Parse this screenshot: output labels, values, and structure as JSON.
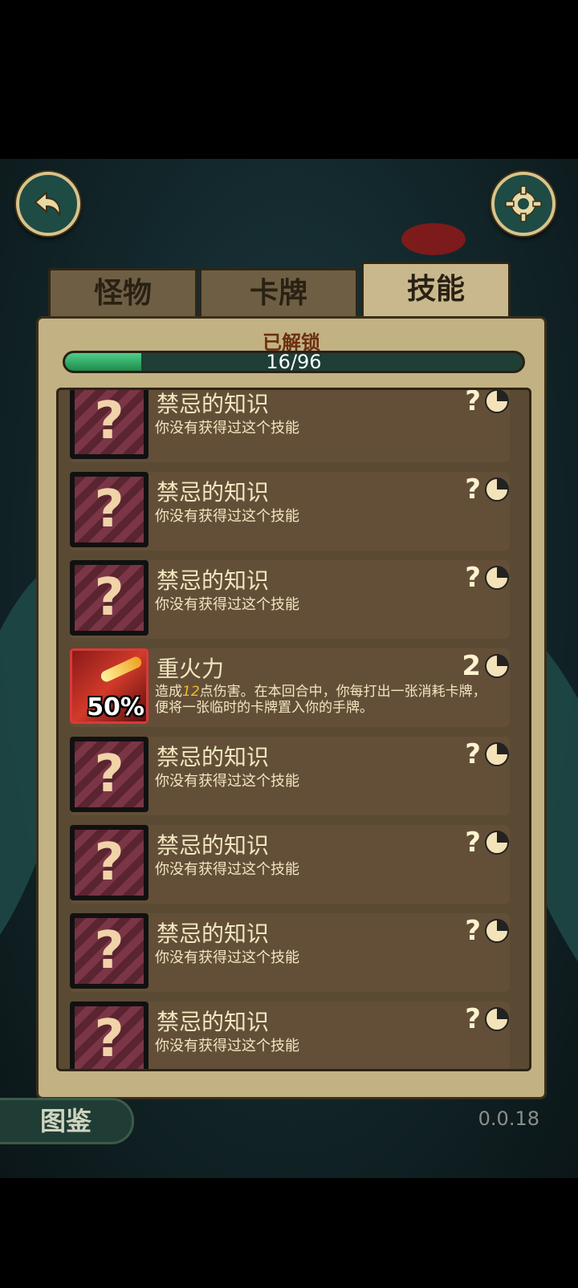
{
  "tabs": [
    {
      "label": "怪物"
    },
    {
      "label": "卡牌"
    },
    {
      "label": "技能"
    }
  ],
  "active_tab": 2,
  "unlocked": {
    "label": "已解锁",
    "progress_text": "16/96",
    "fraction": 0.1667
  },
  "skills": [
    {
      "name": "禁忌的知识",
      "desc": "你没有获得过这个技能",
      "cost": "?"
    },
    {
      "name": "禁忌的知识",
      "desc": "你没有获得过这个技能",
      "cost": "?"
    },
    {
      "name": "禁忌的知识",
      "desc": "你没有获得过这个技能",
      "cost": "?"
    },
    {
      "name": "重火力",
      "desc_pre": "造成",
      "desc_num": "12",
      "desc_post": "点伤害。在本回合中，你每打出一张消耗卡牌，便将一张临时的卡牌置入你的手牌。",
      "cost": "2",
      "badge": "50%"
    },
    {
      "name": "禁忌的知识",
      "desc": "你没有获得过这个技能",
      "cost": "?"
    },
    {
      "name": "禁忌的知识",
      "desc": "你没有获得过这个技能",
      "cost": "?"
    },
    {
      "name": "禁忌的知识",
      "desc": "你没有获得过这个技能",
      "cost": "?"
    },
    {
      "name": "禁忌的知识",
      "desc": "你没有获得过这个技能",
      "cost": "?"
    }
  ],
  "footer": {
    "dex_label": "图鉴",
    "version": "0.0.18"
  },
  "icons": {
    "back": "back-arrow-icon",
    "settings": "gear-icon",
    "locked": "question-mark-icon",
    "cost": "hourglass-pie-icon"
  }
}
